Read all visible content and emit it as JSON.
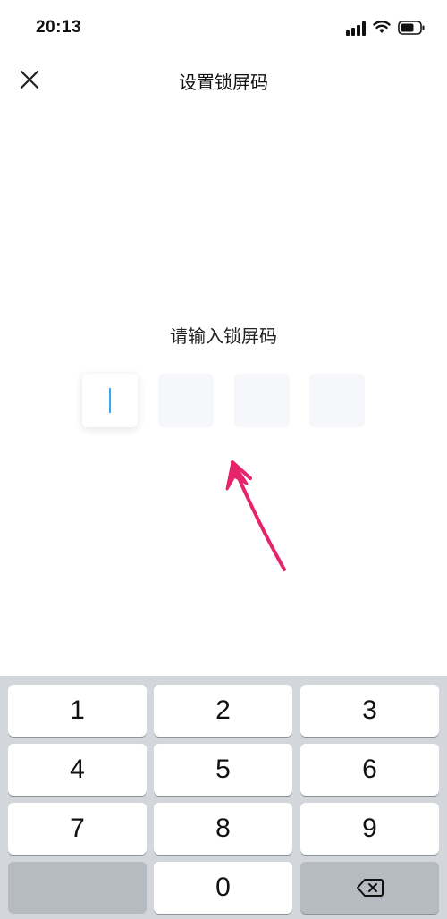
{
  "status_bar": {
    "time": "20:13",
    "icons": [
      "signal-icon",
      "wifi-icon",
      "battery-icon"
    ]
  },
  "nav": {
    "title": "设置锁屏码",
    "close_icon": "close-icon"
  },
  "prompt": "请输入锁屏码",
  "code": {
    "length": 4,
    "entered": "",
    "active_index": 0,
    "cursor_color": "#3aa7e8"
  },
  "annotation": {
    "type": "arrow",
    "color": "#e6246b"
  },
  "keypad": {
    "keys": [
      "1",
      "2",
      "3",
      "4",
      "5",
      "6",
      "7",
      "8",
      "9",
      "",
      "0"
    ],
    "backspace_icon": "backspace-icon",
    "background": "#d3d6db"
  }
}
